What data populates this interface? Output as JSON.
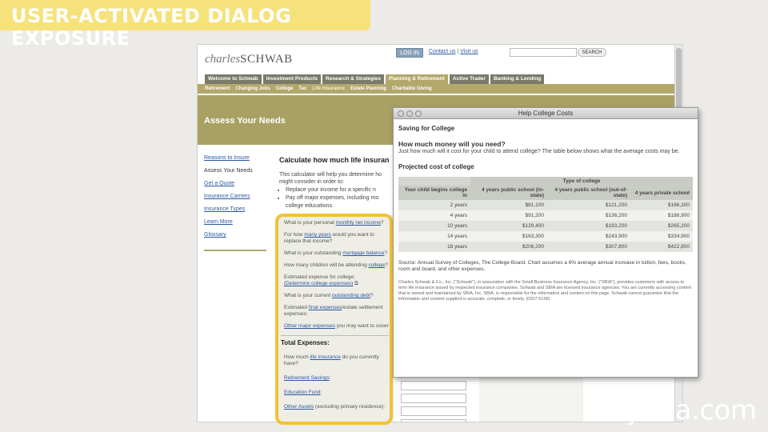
{
  "banner": {
    "title": "USER-ACTIVATED DIALOG EXPOSURE"
  },
  "header": {
    "logo_script": "charles",
    "logo_word": "SCHWAB",
    "login_label": "LOG IN",
    "contact_link": "Contact us",
    "separator": " | ",
    "visit_link": "Visit us",
    "search_label": "SEARCH"
  },
  "nav": {
    "tabs": [
      {
        "label": "Welcome to Schwab"
      },
      {
        "label": "Investment Products"
      },
      {
        "label": "Research & Strategies"
      },
      {
        "label": "Planning & Retirement"
      },
      {
        "label": "Active Trader"
      },
      {
        "label": "Banking & Lending"
      }
    ]
  },
  "subnav": {
    "items": [
      {
        "label": "Retirement"
      },
      {
        "label": "Changing Jobs"
      },
      {
        "label": "College"
      },
      {
        "label": "Tax"
      },
      {
        "label": "Life Insurance"
      },
      {
        "label": "Estate Planning"
      },
      {
        "label": "Charitable Giving"
      }
    ]
  },
  "hero": {
    "title": "Assess Your Needs"
  },
  "left_nav": {
    "items": [
      {
        "label": "Reasons to Insure"
      },
      {
        "label": "Assess Your Needs"
      },
      {
        "label": "Get a Quote"
      },
      {
        "label": "Insurance Carriers"
      },
      {
        "label": "Insurance Types"
      },
      {
        "label": "Learn More"
      },
      {
        "label": "Glossary"
      }
    ]
  },
  "calculator": {
    "heading": "Calculate how much life insuran",
    "intro_1": "This calculator will help you determine ho",
    "intro_2": "might consider in order to:",
    "bullet_1": "Replace your income for a specific n",
    "bullet_2": "Pay off major expenses, including mo",
    "bullet_3": "college educations.",
    "q1_a": "What is your personal ",
    "q1_link": "monthly net income",
    "q1_b": "?",
    "q2_a": "For how ",
    "q2_link": "many years",
    "q2_b": " would you want to replace that income?",
    "q3_a": "What is your outstanding ",
    "q3_link": "mortgage balance",
    "q3_b": "?",
    "q4_a": "How many children will be attending ",
    "q4_link": "college",
    "q4_b": "?",
    "q5_a": "Estimated expense for college:",
    "q5_link": "(Determine college expenses)",
    "q6_a": "What is your current ",
    "q6_link": "outstanding debt",
    "q6_b": "?",
    "q7_a": "Estimated ",
    "q7_link": "final expenses",
    "q7_b": "/estate settlement expenses:",
    "q8_link": "Other major expenses",
    "q8_b": " you may want to cover",
    "total_label": "Total Expenses:",
    "q9_a": "How much ",
    "q9_link": "life insurance",
    "q9_b": " do you currently have?",
    "q10_link": "Retirement Savings",
    "q10_b": ":",
    "q11_link": "Education Fund",
    "q11_b": ":",
    "q12_link": "Other Assets",
    "q12_b": " (excluding primary residence):"
  },
  "popup": {
    "title": "Help College Costs",
    "heading": "Saving for College",
    "question": "How much money will you need?",
    "question_text": "Just how much will it cost for your child to attend college? The table below shows what the average costs may be.",
    "table_heading": "Projected cost of college",
    "table": {
      "group_header": "Type of college",
      "columns": [
        "Your child begins college in",
        "4 years public school (in-state)",
        "4 years public school (out-of-state)",
        "4 years private school"
      ],
      "rows": [
        [
          "2 years",
          "$81,100",
          "$121,200",
          "$166,300"
        ],
        [
          "4 years",
          "$91,200",
          "$136,200",
          "$186,900"
        ],
        [
          "10 years",
          "$129,400",
          "$193,200",
          "$265,200"
        ],
        [
          "14 years",
          "$163,300",
          "$243,900",
          "$334,900"
        ],
        [
          "18 years",
          "$206,200",
          "$307,800",
          "$422,800"
        ]
      ]
    },
    "source": "Source: Annual Survey of Colleges, The College Board. Chart assumes a 6% average annual increase in tuition, fees, books, room and board, and other expenses.",
    "legal": "Charles Schwab & Co., Inc. (\"Schwab\"), in association with the Small Business Insurance Agency, Inc. (\"SBIA\"), provides customers with access to term life insurance issued by respected insurance companies. Schwab and SBIA are licensed insurance agencies. You are currently accessing content that is owned and maintained by SBIA, Inc. SBIA, is responsible for the information and content on this page. Schwab cannot guarantee that the information and content supplied is accurate, complete, or timely. (0207-0158)"
  },
  "watermark": {
    "text": "lynda.com"
  },
  "colors": {
    "banner": "#f6e27a",
    "highlight": "#f2c233",
    "nav_tab": "#7a7a6a",
    "nav_active": "#b3a76b",
    "hero": "#a8a163",
    "link": "#2a58a0"
  }
}
